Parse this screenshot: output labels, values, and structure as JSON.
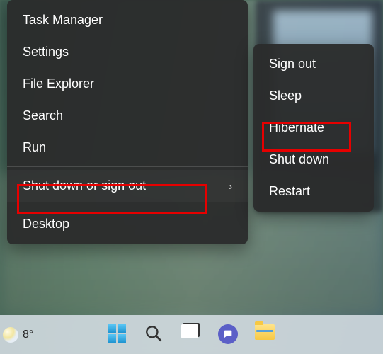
{
  "context_menu": {
    "items": [
      {
        "label": "Task Manager"
      },
      {
        "label": "Settings"
      },
      {
        "label": "File Explorer"
      },
      {
        "label": "Search"
      },
      {
        "label": "Run"
      }
    ],
    "shutdown_item": {
      "label": "Shut down or sign out",
      "has_submenu": true,
      "selected": true
    },
    "desktop_item": {
      "label": "Desktop"
    }
  },
  "submenu": {
    "items": [
      {
        "label": "Sign out"
      },
      {
        "label": "Sleep"
      },
      {
        "label": "Hibernate",
        "highlighted": true
      },
      {
        "label": "Shut down"
      },
      {
        "label": "Restart"
      }
    ]
  },
  "taskbar": {
    "weather_text": "8°",
    "icons": {
      "start": "start-icon",
      "search": "search-icon",
      "taskview": "task-view-icon",
      "chat": "chat-icon",
      "explorer": "file-explorer-icon"
    }
  },
  "highlight_color": "#e60000",
  "chevron_glyph": "›"
}
